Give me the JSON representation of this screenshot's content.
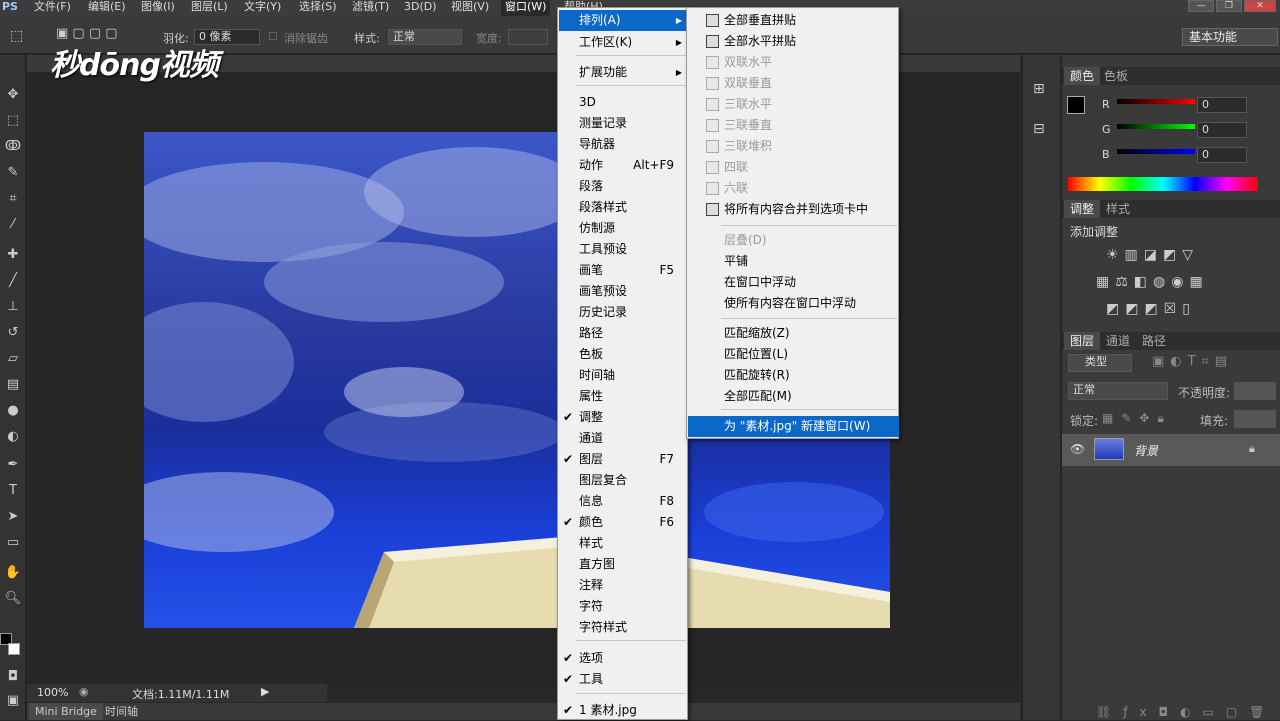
{
  "app": {
    "logo_text": "PS",
    "watermark": "秒dōng视频"
  },
  "menubar": {
    "items": [
      "文件(F)",
      "编辑(E)",
      "图像(I)",
      "图层(L)",
      "文字(Y)",
      "选择(S)",
      "滤镜(T)",
      "3D(D)",
      "视图(V)",
      "窗口(W)",
      "帮助(H)"
    ],
    "window_controls": [
      "—",
      "❐",
      "✕"
    ]
  },
  "options": {
    "feather_label": "羽化:",
    "feather_value": "0 像素",
    "antialias_label": "消除锯齿",
    "style_label": "样式:",
    "style_value": "正常",
    "width_label": "宽度:",
    "workspace": "基本功能"
  },
  "window_menu": {
    "items": [
      {
        "label": "排列(A)",
        "arrow": "▶",
        "selected": true
      },
      {
        "label": "工作区(K)",
        "arrow": "▶"
      },
      {
        "label": "扩展功能",
        "arrow": "▶"
      },
      {
        "label": "3D"
      },
      {
        "label": "测量记录"
      },
      {
        "label": "导航器"
      },
      {
        "label": "动作",
        "shortcut": "Alt+F9"
      },
      {
        "label": "段落"
      },
      {
        "label": "段落样式"
      },
      {
        "label": "仿制源"
      },
      {
        "label": "工具预设"
      },
      {
        "label": "画笔",
        "shortcut": "F5"
      },
      {
        "label": "画笔预设"
      },
      {
        "label": "历史记录"
      },
      {
        "label": "路径"
      },
      {
        "label": "色板"
      },
      {
        "label": "时间轴"
      },
      {
        "label": "属性"
      },
      {
        "label": "调整",
        "checked": "✔"
      },
      {
        "label": "通道"
      },
      {
        "label": "图层",
        "checked": "✔",
        "shortcut": "F7"
      },
      {
        "label": "图层复合"
      },
      {
        "label": "信息",
        "shortcut": "F8"
      },
      {
        "label": "颜色",
        "checked": "✔",
        "shortcut": "F6"
      },
      {
        "label": "样式"
      },
      {
        "label": "直方图"
      },
      {
        "label": "注释"
      },
      {
        "label": "字符"
      },
      {
        "label": "字符样式"
      },
      {
        "label": "选项",
        "checked": "✔"
      },
      {
        "label": "工具",
        "checked": "✔"
      },
      {
        "label": "1 素材.jpg",
        "checked": "✔"
      }
    ]
  },
  "arrange_submenu": {
    "items": [
      {
        "label": "全部垂直拼贴",
        "enabled": true
      },
      {
        "label": "全部水平拼贴",
        "enabled": true
      },
      {
        "label": "双联水平",
        "enabled": false
      },
      {
        "label": "双联垂直",
        "enabled": false
      },
      {
        "label": "三联水平",
        "enabled": false
      },
      {
        "label": "三联垂直",
        "enabled": false
      },
      {
        "label": "三联堆积",
        "enabled": false
      },
      {
        "label": "四联",
        "enabled": false
      },
      {
        "label": "六联",
        "enabled": false
      },
      {
        "label": "将所有内容合并到选项卡中",
        "enabled": true
      },
      {
        "label": "层叠(D)",
        "enabled": false
      },
      {
        "label": "平铺",
        "enabled": true
      },
      {
        "label": "在窗口中浮动",
        "enabled": true
      },
      {
        "label": "使所有内容在窗口中浮动",
        "enabled": true
      },
      {
        "label": "匹配缩放(Z)",
        "enabled": true
      },
      {
        "label": "匹配位置(L)",
        "enabled": true
      },
      {
        "label": "匹配旋转(R)",
        "enabled": true
      },
      {
        "label": "全部匹配(M)",
        "enabled": true
      },
      {
        "label": "为 \"素材.jpg\" 新建窗口(W)",
        "enabled": true,
        "selected": true
      }
    ]
  },
  "color_panel": {
    "tabs": [
      "颜色",
      "色板"
    ],
    "channels": [
      {
        "label": "R",
        "value": "0"
      },
      {
        "label": "G",
        "value": "0"
      },
      {
        "label": "B",
        "value": "0"
      }
    ]
  },
  "adjust_panel": {
    "tabs": [
      "调整",
      "样式"
    ],
    "title": "添加调整"
  },
  "layers_panel": {
    "tabs": [
      "图层",
      "通道",
      "路径"
    ],
    "filter_label": "类型",
    "blend_mode": "正常",
    "opacity_label": "不透明度:",
    "lock_label": "锁定:",
    "fill_label": "填充:",
    "layer_name": "背景"
  },
  "status": {
    "zoom": "100%",
    "doc": "文档:1.11M/1.11M"
  },
  "bottom_tabs": [
    "Mini Bridge",
    "时间轴"
  ],
  "colors": {
    "accent": "#0a68c8",
    "panel": "#3a3a3a",
    "menu_bg": "#f0f0f0"
  }
}
